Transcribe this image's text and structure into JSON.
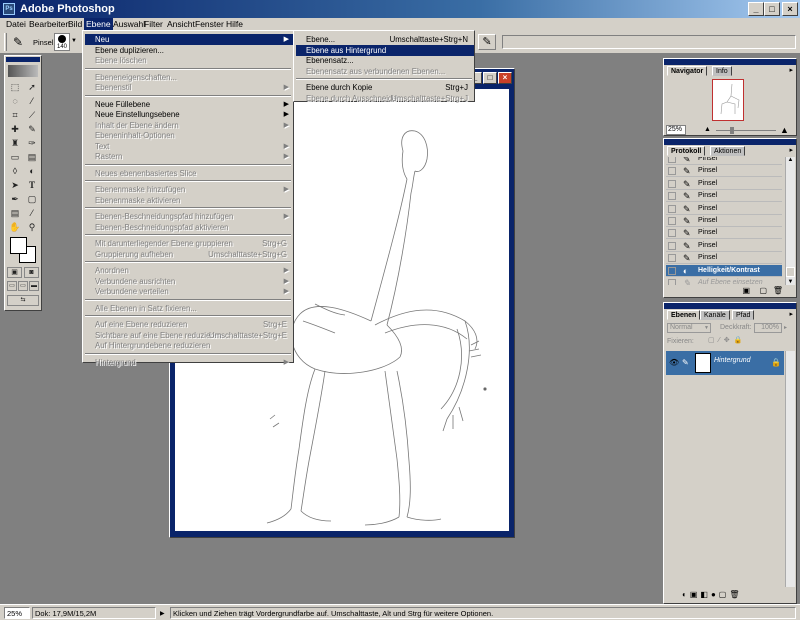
{
  "window": {
    "title": "Adobe Photoshop",
    "minimize": "_",
    "maximize": "□",
    "close": "×"
  },
  "menubar": [
    {
      "label": "Datei"
    },
    {
      "label": "Bearbeiten"
    },
    {
      "label": "Bild"
    },
    {
      "label": "Ebene",
      "active": true
    },
    {
      "label": "Auswahl"
    },
    {
      "label": "Filter"
    },
    {
      "label": "Ansicht"
    },
    {
      "label": "Fenster"
    },
    {
      "label": "Hilfe"
    }
  ],
  "options": {
    "brush_label": "Pinsel:",
    "brush_size": "140"
  },
  "ebene_menu": [
    {
      "label": "Neu",
      "arrow": true,
      "highlighted": true
    },
    {
      "label": "Ebene duplizieren..."
    },
    {
      "label": "Ebene löschen",
      "disabled": true
    },
    {
      "separator": true
    },
    {
      "label": "Ebeneneigenschaften...",
      "disabled": true
    },
    {
      "label": "Ebenenstil",
      "arrow": true,
      "disabled": true
    },
    {
      "separator": true
    },
    {
      "label": "Neue Füllebene",
      "arrow": true
    },
    {
      "label": "Neue Einstellungsebene",
      "arrow": true
    },
    {
      "label": "Inhalt der Ebene ändern",
      "arrow": true,
      "disabled": true
    },
    {
      "label": "Ebeneninhalt-Optionen",
      "disabled": true
    },
    {
      "label": "Text",
      "arrow": true,
      "disabled": true
    },
    {
      "label": "Rastern",
      "arrow": true,
      "disabled": true
    },
    {
      "separator": true
    },
    {
      "label": "Neues ebenenbasiertes Slice",
      "disabled": true
    },
    {
      "separator": true
    },
    {
      "label": "Ebenenmaske hinzufügen",
      "arrow": true,
      "disabled": true
    },
    {
      "label": "Ebenenmaske aktivieren",
      "disabled": true
    },
    {
      "separator": true
    },
    {
      "label": "Ebenen-Beschneidungspfad hinzufügen",
      "arrow": true,
      "disabled": true
    },
    {
      "label": "Ebenen-Beschneidungspfad aktivieren",
      "disabled": true
    },
    {
      "separator": true
    },
    {
      "label": "Mit darunterliegender Ebene gruppieren",
      "shortcut": "Strg+G",
      "disabled": true
    },
    {
      "label": "Gruppierung aufheben",
      "shortcut": "Umschalttaste+Strg+G",
      "disabled": true
    },
    {
      "separator": true
    },
    {
      "label": "Anordnen",
      "arrow": true,
      "disabled": true
    },
    {
      "label": "Verbundene ausrichten",
      "arrow": true,
      "disabled": true
    },
    {
      "label": "Verbundene verteilen",
      "arrow": true,
      "disabled": true
    },
    {
      "separator": true
    },
    {
      "label": "Alle Ebenen in Satz fixieren...",
      "disabled": true
    },
    {
      "separator": true
    },
    {
      "label": "Auf eine Ebene reduzieren",
      "shortcut": "Strg+E",
      "disabled": true
    },
    {
      "label": "Sichtbare auf eine Ebene reduzieren",
      "shortcut": "Umschalttaste+Strg+E",
      "disabled": true
    },
    {
      "label": "Auf Hintergrundebene reduzieren",
      "disabled": true
    },
    {
      "separator": true
    },
    {
      "label": "Hintergrund",
      "arrow": true,
      "disabled": true
    }
  ],
  "neu_submenu": [
    {
      "label": "Ebene...",
      "shortcut": "Umschalttaste+Strg+N"
    },
    {
      "label": "Ebene aus Hintergrund",
      "highlighted": true
    },
    {
      "label": "Ebenensatz..."
    },
    {
      "label": "Ebenensatz aus verbundenen Ebenen...",
      "disabled": true
    },
    {
      "separator": true
    },
    {
      "label": "Ebene durch Kopie",
      "shortcut": "Strg+J"
    },
    {
      "label": "Ebene durch Ausschneiden",
      "shortcut": "Umschalttaste+Strg+J",
      "disabled": true
    }
  ],
  "navigator": {
    "tabs": [
      "Navigator",
      "Info"
    ],
    "zoom": "25%"
  },
  "history": {
    "tabs": [
      "Protokoll",
      "Aktionen"
    ],
    "items": [
      {
        "label": "Pinsel"
      },
      {
        "label": "Pinsel"
      },
      {
        "label": "Pinsel"
      },
      {
        "label": "Pinsel"
      },
      {
        "label": "Pinsel"
      },
      {
        "label": "Pinsel"
      },
      {
        "label": "Pinsel"
      },
      {
        "label": "Pinsel"
      },
      {
        "label": "Pinsel"
      },
      {
        "label": "Helligkeit/Kontrast",
        "selected": true
      },
      {
        "label": "Auf Ebene einsetzen",
        "dimmed": true
      }
    ]
  },
  "layers": {
    "tabs": [
      "Ebenen",
      "Kanäle",
      "Pfad"
    ],
    "blend_mode": "Normal",
    "opacity_label": "Deckkraft:",
    "opacity_value": "100%",
    "lock_label": "Fixieren:",
    "layer_name": "Hintergrund"
  },
  "status": {
    "zoom": "25%",
    "doc": "Dok: 17,9M/15,2M",
    "hint": "Klicken und Ziehen trägt Vordergrundfarbe auf. Umschalttaste, Alt und Strg für weitere Optionen."
  }
}
